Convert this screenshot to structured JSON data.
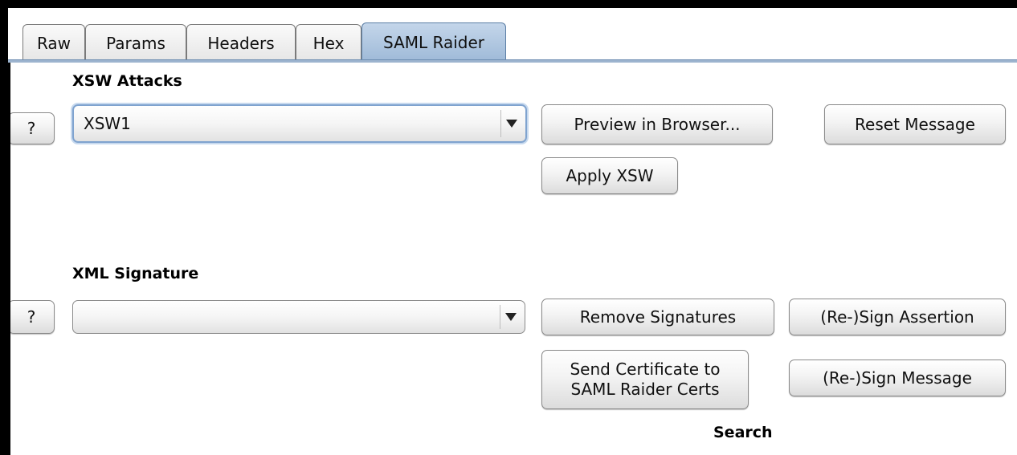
{
  "tabs": [
    {
      "label": "Raw",
      "active": false
    },
    {
      "label": "Params",
      "active": false
    },
    {
      "label": "Headers",
      "active": false
    },
    {
      "label": "Hex",
      "active": false
    },
    {
      "label": "SAML Raider",
      "active": true
    }
  ],
  "xsw": {
    "title": "XSW Attacks",
    "help_label": "?",
    "selected": "XSW1",
    "preview_label": "Preview in Browser...",
    "reset_label": "Reset Message",
    "apply_label": "Apply XSW"
  },
  "signature": {
    "title": "XML Signature",
    "help_label": "?",
    "selected": "",
    "remove_label": "Remove Signatures",
    "sign_assertion_label": "(Re-)Sign Assertion",
    "send_cert_line1": "Send Certificate to",
    "send_cert_line2": "SAML Raider Certs",
    "sign_message_label": "(Re-)Sign Message"
  },
  "search_label": "Search",
  "colors": {
    "active_tab": "#a9c2de",
    "focus_ring": "#7fa3cf",
    "background": "#ffffff"
  }
}
